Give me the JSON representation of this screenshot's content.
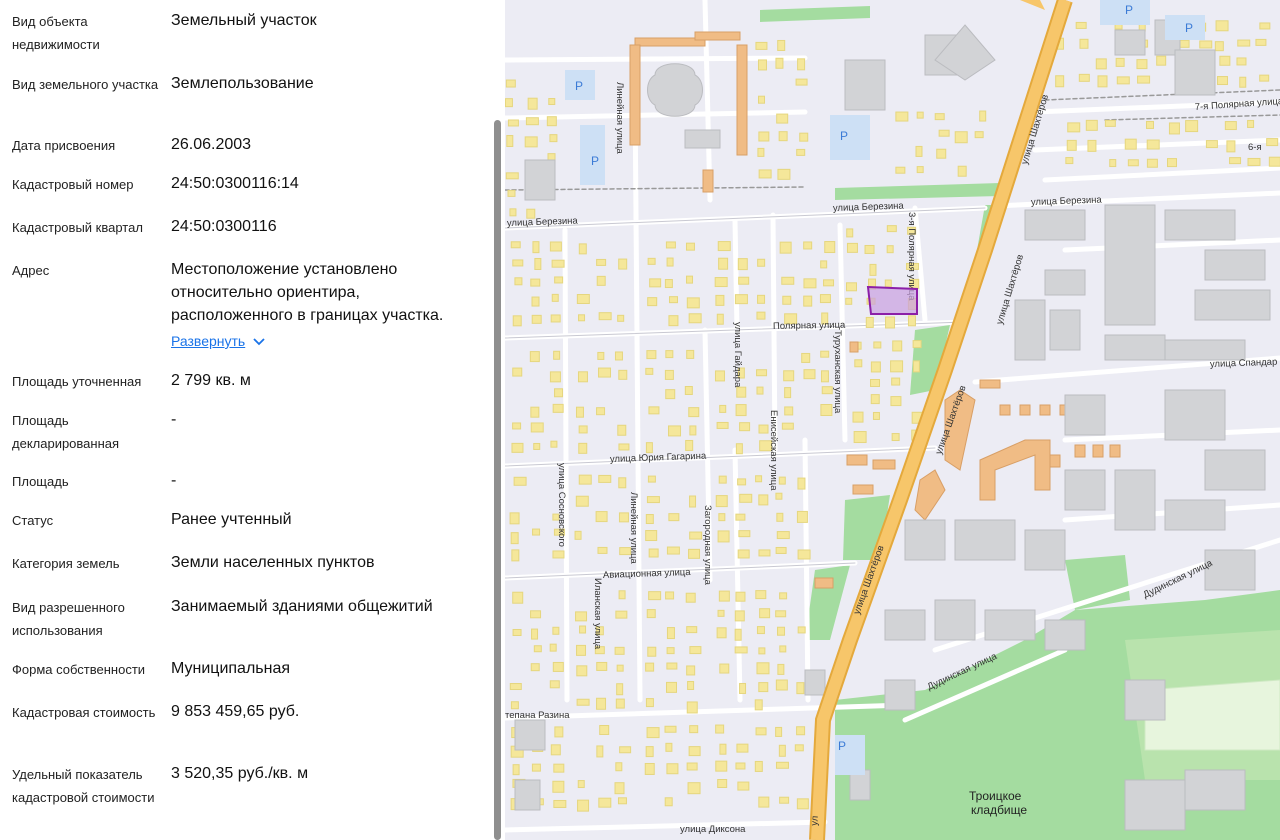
{
  "panel": {
    "fields": [
      {
        "label": "Вид объекта недвижимости",
        "value": "Земельный участок"
      },
      {
        "label": "Вид земельного участка",
        "value": "Землепользование"
      },
      {
        "label": "Дата присвоения",
        "value": "26.06.2003"
      },
      {
        "label": "Кадастровый номер",
        "value": "24:50:0300116:14"
      },
      {
        "label": "Кадастровый квартал",
        "value": "24:50:0300116"
      },
      {
        "label": "Адрес",
        "value": "Местоположение установлено относительно ориентира, расположенного в границах участка."
      },
      {
        "label": "Площадь уточненная",
        "value": "2 799 кв. м"
      },
      {
        "label": "Площадь декларированная",
        "value": "-"
      },
      {
        "label": "Площадь",
        "value": "-"
      },
      {
        "label": "Статус",
        "value": "Ранее учтенный"
      },
      {
        "label": "Категория земель",
        "value": "Земли населенных пунктов"
      },
      {
        "label": "Вид разрешенного использования",
        "value": "Занимаемый зданиями общежитий"
      },
      {
        "label": "Форма собственности",
        "value": "Муниципальная"
      },
      {
        "label": "Кадастровая стоимость",
        "value": "9 853 459,65 руб."
      },
      {
        "label": "Удельный показатель кадастровой стоимости",
        "value": "3 520,35 руб./кв. м"
      }
    ],
    "expand_label": "Развернуть",
    "expand_icon": "chevron-down-icon"
  },
  "map": {
    "streets": {
      "berezina_w": "улица Березина",
      "berezina_e": "улица Березина",
      "polar_3": "3-я Полярная улица",
      "polar_7": "7-я Полярная улица",
      "polar_6": "6-я",
      "polyarnaya": "Полярная улица",
      "shakhterov_n": "улица Шахтёров",
      "shakhterov_m": "улица Шахтёров",
      "shakhterov_s": "улица Шахтёров",
      "shakhterov_bottom": "ул",
      "lineynaya_n": "Линейная улица",
      "lineynaya_s": "Линейная улица",
      "gaidara": "улица Гайдара",
      "turukhanskaya": "Туруханская улица",
      "eniseyskaya": "Енисейская улица",
      "gagarina": "улица Юрия Гагарина",
      "sosnovskogo": "улица Сосновского",
      "zagorodnaya": "Загородная улица",
      "aviatsionnaya": "Авиационная улица",
      "ilanskaya": "Иланская улица",
      "spandar": "улица Спандар",
      "dudinskaya_e": "Дудинская улица",
      "dudinskaya_w": "Дудинская улица",
      "razina": "тепана Разина",
      "diksona": "улица Диксона"
    },
    "poi_cemetery_line1": "Троицкое",
    "poi_cemetery_line2": "кладбище",
    "parking_label": "P",
    "colors": {
      "road_major": "#f7c66a",
      "road_border": "#e4a93c",
      "building_yellow": "#f5e79a",
      "building_orange": "#f0bc85",
      "building_gray": "#d2d3d6",
      "green": "#a4dca0",
      "parcel": "#8c1fa8"
    }
  }
}
